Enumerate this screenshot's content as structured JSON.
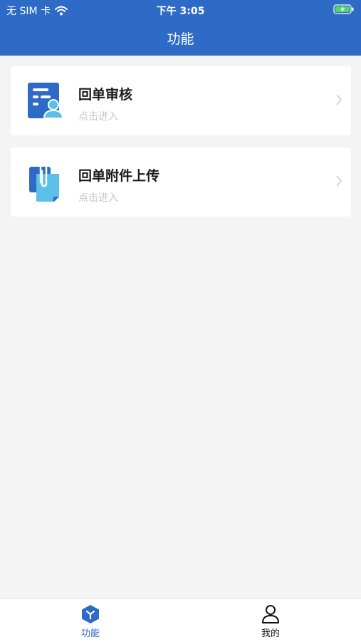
{
  "status_bar": {
    "carrier": "无 SIM 卡",
    "time": "下午 3:05"
  },
  "header": {
    "title": "功能"
  },
  "menu": [
    {
      "title": "回单审核",
      "subtitle": "点击进入",
      "icon": "document-user-icon"
    },
    {
      "title": "回单附件上传",
      "subtitle": "点击进入",
      "icon": "paperclip-upload-icon"
    }
  ],
  "tabbar": {
    "tabs": [
      {
        "label": "功能",
        "icon": "hexagon-function-icon",
        "active": true
      },
      {
        "label": "我的",
        "icon": "user-profile-icon",
        "active": false
      }
    ]
  },
  "colors": {
    "brand": "#2e6bc6",
    "accent_light": "#5bc0e8",
    "background": "#f4f4f4"
  }
}
